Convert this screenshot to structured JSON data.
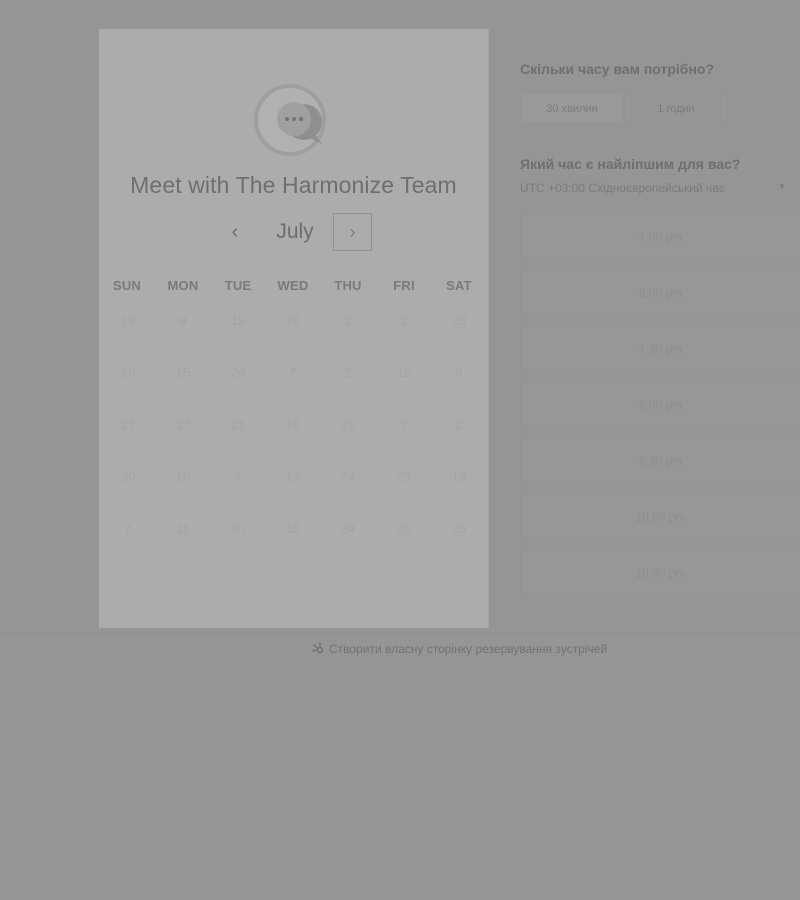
{
  "meeting": {
    "title": "Meet with The Harmonize Team",
    "avatar_icon": "chat-bubble-icon"
  },
  "calendar": {
    "month": "July",
    "prev_icon": "chevron-left-icon",
    "next_icon": "chevron-right-icon",
    "weekdays": [
      "SUN",
      "MON",
      "TUE",
      "WED",
      "THU",
      "FRI",
      "SAT"
    ],
    "weeks": [
      [
        "13",
        "9",
        "19",
        "26",
        "2",
        "2",
        "28"
      ],
      [
        "16",
        "15",
        "26",
        "7",
        "2",
        "12",
        "9"
      ],
      [
        "27",
        "27",
        "21",
        "16",
        "21",
        "7",
        "2"
      ],
      [
        "30",
        "16",
        "7",
        "17",
        "24",
        "28",
        "19"
      ],
      [
        "7",
        "11",
        "20",
        "15",
        "24",
        "25",
        "26"
      ]
    ]
  },
  "duration": {
    "title": "Скільки часу вам потрібно?",
    "options": [
      "30 хвилин",
      "1 годин"
    ]
  },
  "time": {
    "title": "Який час є найліпшим для вас?",
    "timezone": "UTC +03:00 Східноєвропейський час",
    "timezone_icon": "caret-down-icon",
    "slots": [
      "7:00 pm",
      "8:00 pm",
      "7:30 pm",
      "9:00 pm",
      "9:30 pm",
      "10:00 pm",
      "10:30 pm"
    ]
  },
  "footer": {
    "label": "Створити власну сторінку резервування зустрічей",
    "icon": "sprocket-icon"
  }
}
